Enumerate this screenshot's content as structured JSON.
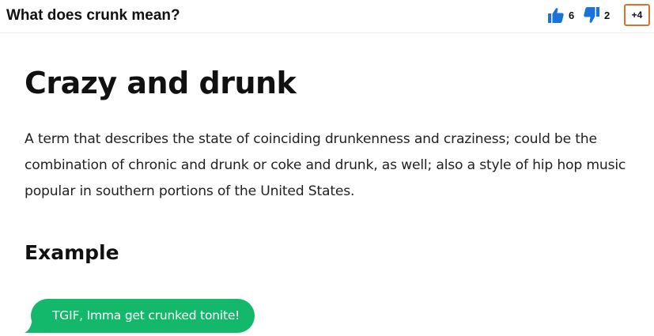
{
  "header": {
    "question": "What does crunk mean?",
    "upvote_count": "6",
    "downvote_count": "2",
    "plus_badge": "+4",
    "icons": {
      "upvote": "thumbs-up-icon",
      "downvote": "thumbs-down-icon"
    },
    "colors": {
      "thumb": "#1a73d9",
      "badge_border": "#d9722b"
    }
  },
  "entry": {
    "headword": "Crazy and drunk",
    "definition": "A term that describes the state of coinciding drunkenness and craziness; could be the combination of chronic and drunk or coke and drunk, as well; also a style of hip hop music popular in southern portions of the United States.",
    "example_heading": "Example",
    "example_message": "TGIF, Imma get crunked tonite!",
    "colors": {
      "bubble": "#14b86a"
    }
  }
}
